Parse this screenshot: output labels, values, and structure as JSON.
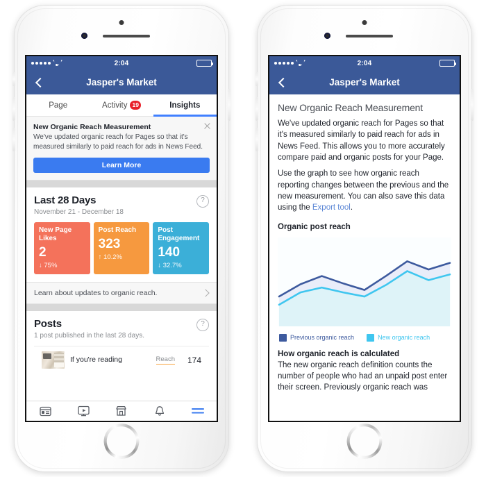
{
  "meta": {
    "accent_blue": "#3b5998",
    "button_blue": "#3a7bf0",
    "tab_indicator": "#4080ff",
    "badge_red": "#e8202a",
    "series_prev_color": "#3d5a9e",
    "series_new_color": "#3fc6ef"
  },
  "status_bar": {
    "time": "2:04",
    "signal_icon": "signal-dots-icon",
    "wifi_icon": "wifi-icon",
    "battery_icon": "battery-icon"
  },
  "nav": {
    "back_icon": "chevron-left-icon",
    "title": "Jasper's Market"
  },
  "left_phone": {
    "tabs": [
      {
        "label": "Page",
        "active": false,
        "badge": ""
      },
      {
        "label": "Activity",
        "active": false,
        "badge": "19"
      },
      {
        "label": "Insights",
        "active": true,
        "badge": ""
      }
    ],
    "banner": {
      "title": "New Organic Reach Measurement",
      "body": "We've updated organic reach for Pages so that it's measured similarly to paid reach for ads in News Feed.",
      "close_icon": "close-icon",
      "cta_label": "Learn More"
    },
    "insights": {
      "title": "Last 28 Days",
      "date_range": "November 21 - December 18",
      "help_icon": "question-mark-icon",
      "help_glyph": "?",
      "stats": [
        {
          "label": "New Page Likes",
          "value": "2",
          "delta": "↓ 75%",
          "color": "#f4725b"
        },
        {
          "label": "Post Reach",
          "value": "323",
          "delta": "↑ 10.2%",
          "color": "#f6993f"
        },
        {
          "label": "Post Engagement",
          "value": "140",
          "delta": "↓ 32.7%",
          "color": "#3bafd8"
        }
      ]
    },
    "learn_row": {
      "label": "Learn about updates to organic reach.",
      "chevron_icon": "chevron-right-icon"
    },
    "posts": {
      "title": "Posts",
      "subtitle": "1 post published in the last 28 days.",
      "help_glyph": "?",
      "row": {
        "thumbnail": "post-thumbnail",
        "title": "If you're reading",
        "metric_label": "Reach",
        "metric_value": "174"
      }
    },
    "bottom_nav": [
      {
        "icon": "news-feed-icon",
        "active": false
      },
      {
        "icon": "video-watch-icon",
        "active": false
      },
      {
        "icon": "marketplace-icon",
        "active": false
      },
      {
        "icon": "notifications-bell-icon",
        "active": false
      },
      {
        "icon": "hamburger-menu-icon",
        "active": true
      }
    ]
  },
  "right_phone": {
    "heading": "New Organic Reach Measurement",
    "paragraph_1": "We've updated organic reach for Pages so that it's measured similarly to paid reach for ads in News Feed. This allows you to more accurately compare paid and organic posts for your Page.",
    "paragraph_2_pre": "Use the graph to see how organic reach reporting changes between the previous and the new measurement. You can also save this data using the ",
    "paragraph_2_link": "Export tool",
    "paragraph_2_post": ".",
    "chart_title": "Organic post reach",
    "section_heading": "How organic reach is calculated",
    "section_body": "The new organic reach definition counts the number of people who had an unpaid post enter their screen. Previously organic reach was"
  },
  "chart_data": {
    "type": "area",
    "title": "Organic post reach",
    "xlabel": "",
    "ylabel": "",
    "grid": false,
    "legend_position": "bottom",
    "x": [
      1,
      2,
      3,
      4,
      5,
      6,
      7,
      8,
      9
    ],
    "ylim": [
      0,
      100
    ],
    "series": [
      {
        "name": "Previous organic reach",
        "color": "#3d5a9e",
        "values": [
          33,
          48,
          58,
          49,
          41,
          58,
          76,
          66,
          74
        ]
      },
      {
        "name": "New organic reach",
        "color": "#3fc6ef",
        "values": [
          23,
          38,
          44,
          38,
          33,
          47,
          64,
          53,
          60
        ]
      }
    ]
  }
}
